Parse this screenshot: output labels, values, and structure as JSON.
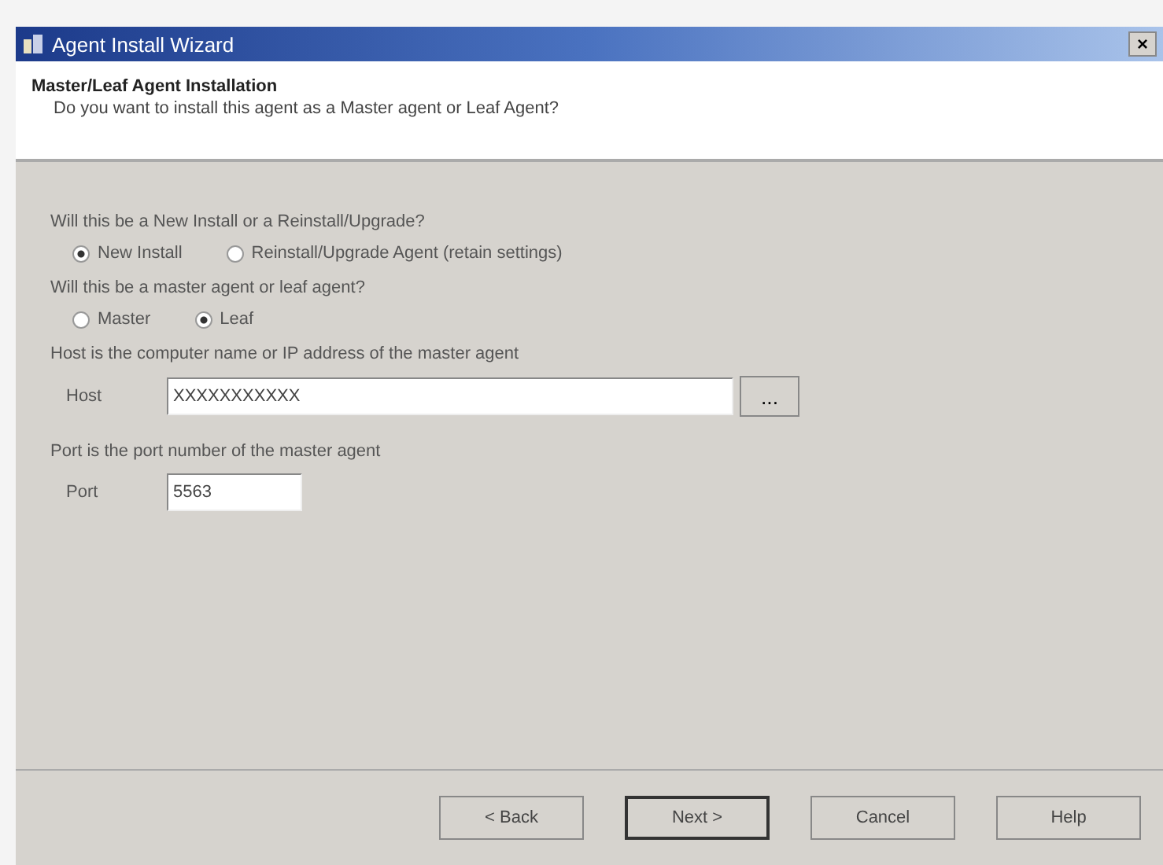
{
  "window": {
    "title": "Agent Install Wizard",
    "close": "×"
  },
  "header": {
    "title": "Master/Leaf Agent Installation",
    "subtitle": "Do you want to install this agent as a Master agent or Leaf Agent?"
  },
  "groups": [
    {
      "question": "Will this be a New Install or a Reinstall/Upgrade?",
      "options": [
        {
          "label": "New Install",
          "selected": true
        },
        {
          "label": "Reinstall/Upgrade Agent (retain settings)",
          "selected": false
        }
      ]
    },
    {
      "question": "Will this be a master agent or leaf agent?",
      "options": [
        {
          "label": "Master",
          "selected": false
        },
        {
          "label": "Leaf",
          "selected": true
        }
      ]
    }
  ],
  "host": {
    "hint": "Host is the computer name or IP address of the master agent",
    "label": "Host",
    "value": "XXXXXXXXXXX",
    "browse": "..."
  },
  "port": {
    "hint": "Port is the port number of the master agent",
    "label": "Port",
    "value": "5563"
  },
  "buttons": [
    {
      "label": "< Back",
      "default": false
    },
    {
      "label": "Next >",
      "default": true
    },
    {
      "label": "Cancel",
      "default": false
    },
    {
      "label": "Help",
      "default": false
    }
  ]
}
